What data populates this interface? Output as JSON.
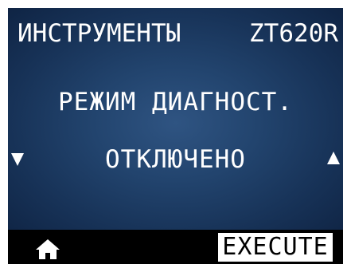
{
  "header": {
    "menu_title": "ИНСТРУМЕНТЫ",
    "printer_model": "ZT620R"
  },
  "setting": {
    "name": "РЕЖИМ ДИАГНОСТ.",
    "value": "ОТКЛЮЧЕНО"
  },
  "navigation": {
    "previous_icon": "triangle-down-icon",
    "next_icon": "triangle-up-icon"
  },
  "softkeys": {
    "home_icon": "home-icon",
    "execute_label": "EXECUTE"
  },
  "colors": {
    "panel_background": "#22446e",
    "text": "#ffffff",
    "bar_background": "#000000"
  }
}
